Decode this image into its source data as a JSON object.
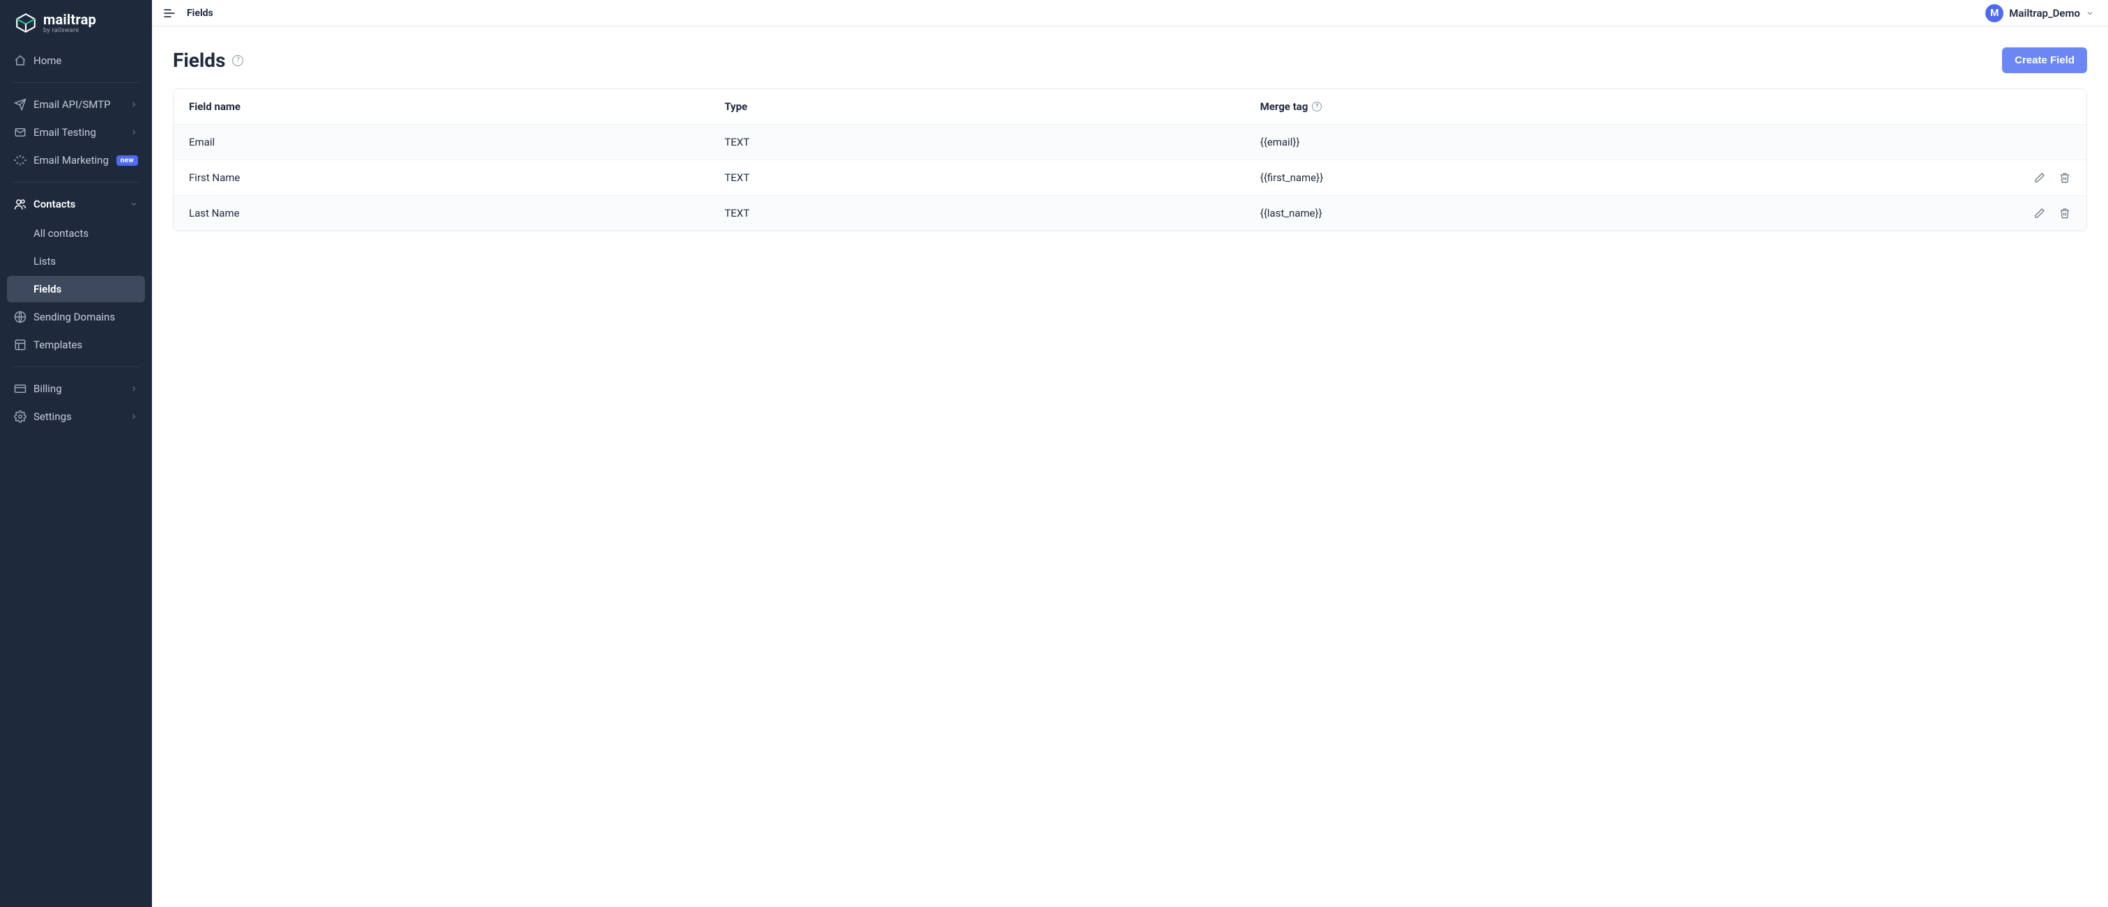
{
  "brand": {
    "name": "mailtrap",
    "byline": "by railsware"
  },
  "sidebar": {
    "home": "Home",
    "email_api": "Email API/SMTP",
    "email_testing": "Email Testing",
    "email_marketing": "Email Marketing",
    "badge_new": "new",
    "contacts": "Contacts",
    "contacts_children": {
      "all_contacts": "All contacts",
      "lists": "Lists",
      "fields": "Fields"
    },
    "sending_domains": "Sending Domains",
    "templates": "Templates",
    "billing": "Billing",
    "settings": "Settings"
  },
  "topbar": {
    "breadcrumb": "Fields",
    "user_initial": "M",
    "user_name": "Mailtrap_Demo"
  },
  "page": {
    "title": "Fields",
    "create_button": "Create Field"
  },
  "table": {
    "columns": {
      "name": "Field name",
      "type": "Type",
      "merge_tag": "Merge tag"
    },
    "rows": [
      {
        "name": "Email",
        "type": "TEXT",
        "merge_tag": "{{email}}",
        "editable": false
      },
      {
        "name": "First Name",
        "type": "TEXT",
        "merge_tag": "{{first_name}}",
        "editable": true
      },
      {
        "name": "Last Name",
        "type": "TEXT",
        "merge_tag": "{{last_name}}",
        "editable": true
      }
    ]
  }
}
